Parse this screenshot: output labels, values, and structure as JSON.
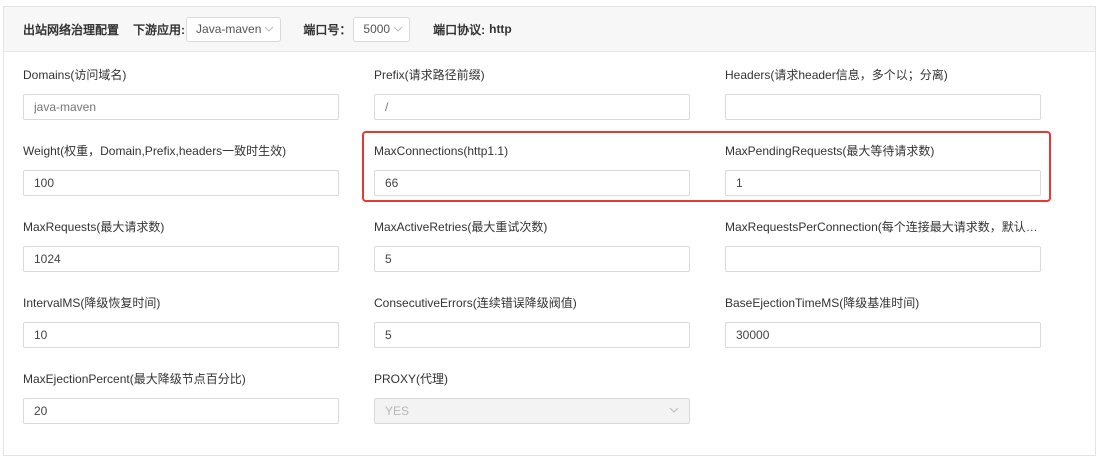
{
  "header": {
    "title": "出站网络治理配置",
    "app_label": "下游应用:",
    "app_value": "Java-maven",
    "port_label": "端口号：",
    "port_value": "5000",
    "protocol_label": "端口协议:",
    "protocol_value": "http"
  },
  "fields": [
    {
      "label": "Domains(访问域名)",
      "value": "",
      "placeholder": "java-maven"
    },
    {
      "label": "Prefix(请求路径前缀)",
      "value": "",
      "placeholder": "/"
    },
    {
      "label": "Headers(请求header信息，多个以；分离)",
      "value": "",
      "placeholder": ""
    },
    {
      "label": "Weight(权重，Domain,Prefix,headers一致时生效)",
      "value": "100"
    },
    {
      "label": "MaxConnections(http1.1)",
      "value": "66"
    },
    {
      "label": "MaxPendingRequests(最大等待请求数)",
      "value": "1"
    },
    {
      "label": "MaxRequests(最大请求数)",
      "value": "1024"
    },
    {
      "label": "MaxActiveRetries(最大重试次数)",
      "value": "5"
    },
    {
      "label": "MaxRequestsPerConnection(每个连接最大请求数，默认不...",
      "value": ""
    },
    {
      "label": "IntervalMS(降级恢复时间)",
      "value": "10"
    },
    {
      "label": "ConsecutiveErrors(连续错误降级阀值)",
      "value": "5"
    },
    {
      "label": "BaseEjectionTimeMS(降级基准时间)",
      "value": "30000"
    },
    {
      "label": "MaxEjectionPercent(最大降级节点百分比)",
      "value": "20"
    }
  ],
  "proxy": {
    "label": "PROXY(代理)",
    "value": "YES"
  },
  "colors": {
    "highlight": "#e53935",
    "header_bg": "#f7f7f7"
  }
}
